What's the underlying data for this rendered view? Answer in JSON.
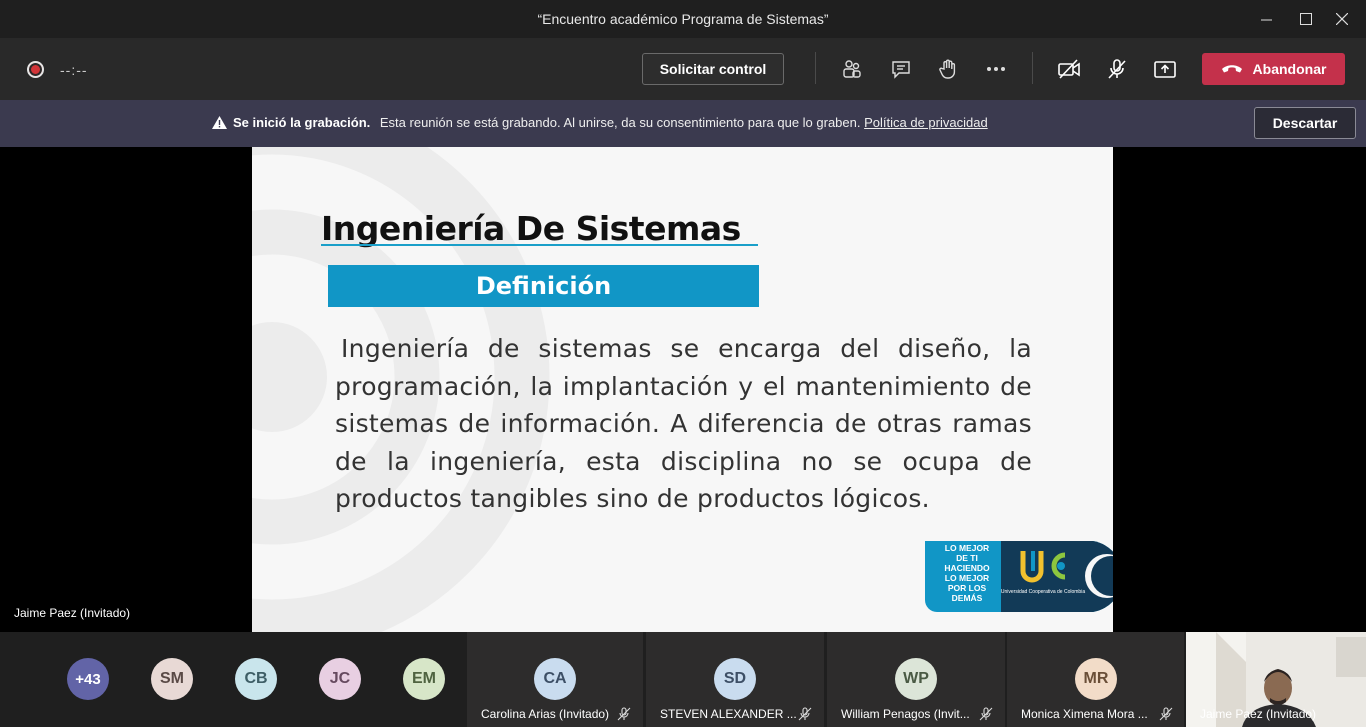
{
  "window": {
    "title": "“Encuentro académico Programa de Sistemas”",
    "minimize_icon": "minimize-icon",
    "maximize_icon": "maximize-icon",
    "close_icon": "close-icon"
  },
  "toolbar": {
    "recording_timer": "--:--",
    "request_control_label": "Solicitar control",
    "leave_label": "Abandonar",
    "icons": [
      "participants-icon",
      "chat-icon",
      "raise-hand-icon",
      "more-options-icon",
      "camera-off-icon",
      "mic-off-icon",
      "share-tray-icon",
      "hang-up-icon"
    ]
  },
  "banner": {
    "title": "Se inició la grabación.",
    "message": "Esta reunión se está grabando. Al unirse, da su consentimiento para que lo graben.",
    "link": "Política de privacidad",
    "dismiss_label": "Descartar"
  },
  "slide": {
    "title": "Ingeniería De Sistemas",
    "section": "Definición",
    "body": "Ingeniería de sistemas se encarga del diseño, la programación, la implantación y el mantenimiento de sistemas de información. A diferencia de otras ramas de la ingeniería, esta disciplina no se ocupa de productos tangibles sino de productos lógicos.",
    "logo_slogan": [
      "LO MEJOR",
      "DE TI",
      "HACIENDO",
      "LO MEJOR",
      "POR LOS",
      "DEMÁS"
    ],
    "logo_university": "Universidad Cooperativa de Colombia"
  },
  "presenter": {
    "name": "Jaime Paez (Invitado)"
  },
  "participants": {
    "overflow_count": "+43",
    "avatars": [
      {
        "initials": "SM",
        "color": "#e8d9d5"
      },
      {
        "initials": "CB",
        "color": "#c9e5ec"
      },
      {
        "initials": "JC",
        "color": "#e8cfe2"
      },
      {
        "initials": "EM",
        "color": "#d7e6c8"
      }
    ],
    "tiles": [
      {
        "initials": "CA",
        "name": "Carolina Arias (Invitado)",
        "color": "#c9dcef"
      },
      {
        "initials": "SD",
        "name": "STEVEN ALEXANDER ...",
        "color": "#c9dcef"
      },
      {
        "initials": "WP",
        "name": "William Penagos (Invit...",
        "color": "#dce5d8"
      },
      {
        "initials": "MR",
        "name": "Monica Ximena Mora ...",
        "color": "#f2dcc8"
      }
    ],
    "video": {
      "name": "Jaime Paez (Invitado)"
    }
  }
}
